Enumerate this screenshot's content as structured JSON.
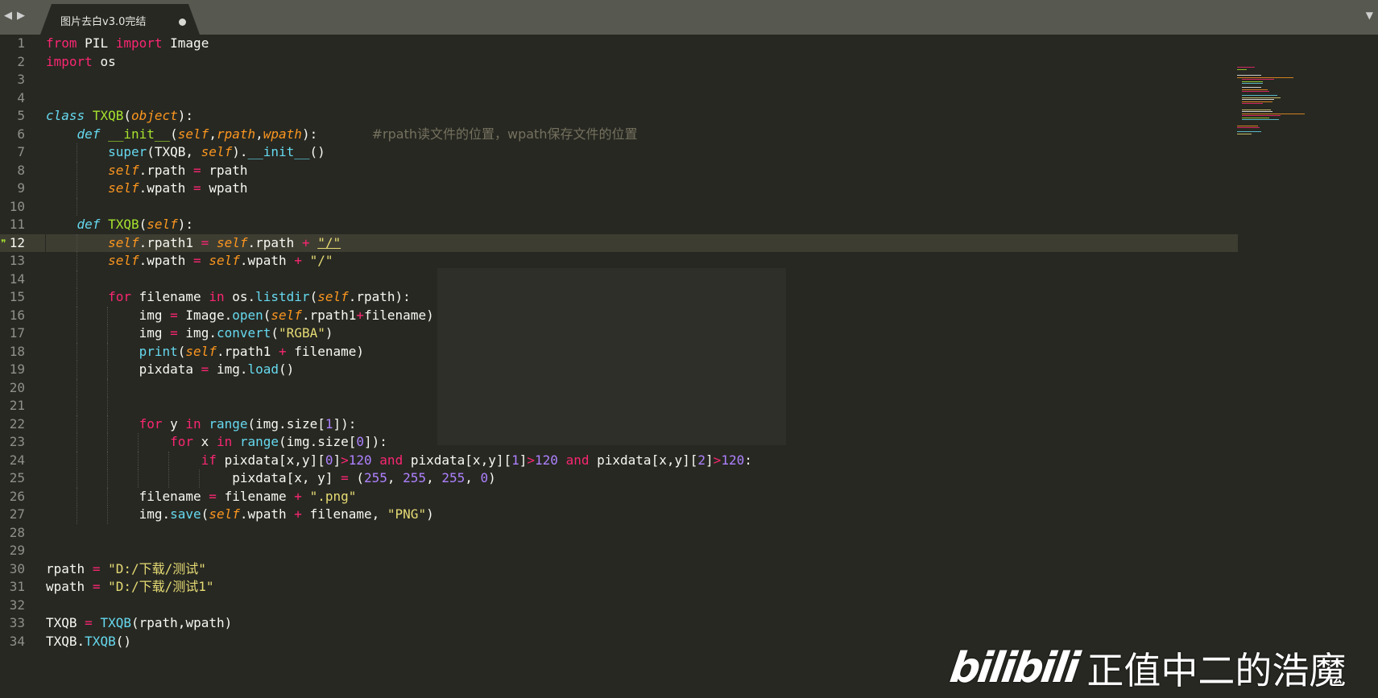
{
  "tabbar": {
    "back_arrow": "◀",
    "forward_arrow": "▶",
    "tab_title": "图片去白v3.0完结",
    "tab_state": "unsaved",
    "menu_arrow": "▼"
  },
  "gutter": {
    "current_line": 12,
    "modified_mark": "❞",
    "line_numbers": [
      "1",
      "2",
      "3",
      "4",
      "5",
      "6",
      "7",
      "8",
      "9",
      "10",
      "11",
      "12",
      "13",
      "14",
      "15",
      "16",
      "17",
      "18",
      "19",
      "20",
      "21",
      "22",
      "23",
      "24",
      "25",
      "26",
      "27",
      "28",
      "29",
      "30",
      "31",
      "32",
      "33",
      "34"
    ]
  },
  "code": {
    "kw_from": "from",
    "kw_import": "import",
    "kw_class": "class",
    "kw_def": "def",
    "kw_for": "for",
    "kw_in": "in",
    "kw_if": "if",
    "kw_and": "and",
    "PIL": "PIL",
    "Image": "Image",
    "os": "os",
    "TXQB": "TXQB",
    "object": "object",
    "__init__": "__init__",
    "self": "self",
    "rpath": "rpath",
    "wpath": "wpath",
    "comment6": "#rpath读文件的位置，wpath保存文件的位置",
    "super": "super",
    "rpath1": "rpath1",
    "str_slash": "\"/\"",
    "filename": "filename",
    "listdir": "listdir",
    "img": "img",
    "open": "open",
    "convert": "convert",
    "str_rgba": "\"RGBA\"",
    "print": "print",
    "pixdata": "pixdata",
    "load": "load",
    "y": "y",
    "x": "x",
    "range": "range",
    "size": "size",
    "n0": "0",
    "n1": "1",
    "n2": "2",
    "n120": "120",
    "n255": "255",
    "str_png_ext": "\".png\"",
    "save": "save",
    "str_png": "\"PNG\"",
    "str_rpath": "\"D:/下载/测试\"",
    "str_wpath": "\"D:/下载/测试1\""
  },
  "watermark": {
    "logo": "bilibili",
    "uploader": "正值中二的浩魔"
  },
  "colors": {
    "background": "#272822",
    "tabbar": "#57584f",
    "keyword": "#f92672",
    "string": "#e6db74",
    "function": "#a6e22e",
    "builtin": "#66d9ef",
    "parameter": "#fd971f",
    "number": "#ae81ff",
    "comment": "#75715e"
  }
}
